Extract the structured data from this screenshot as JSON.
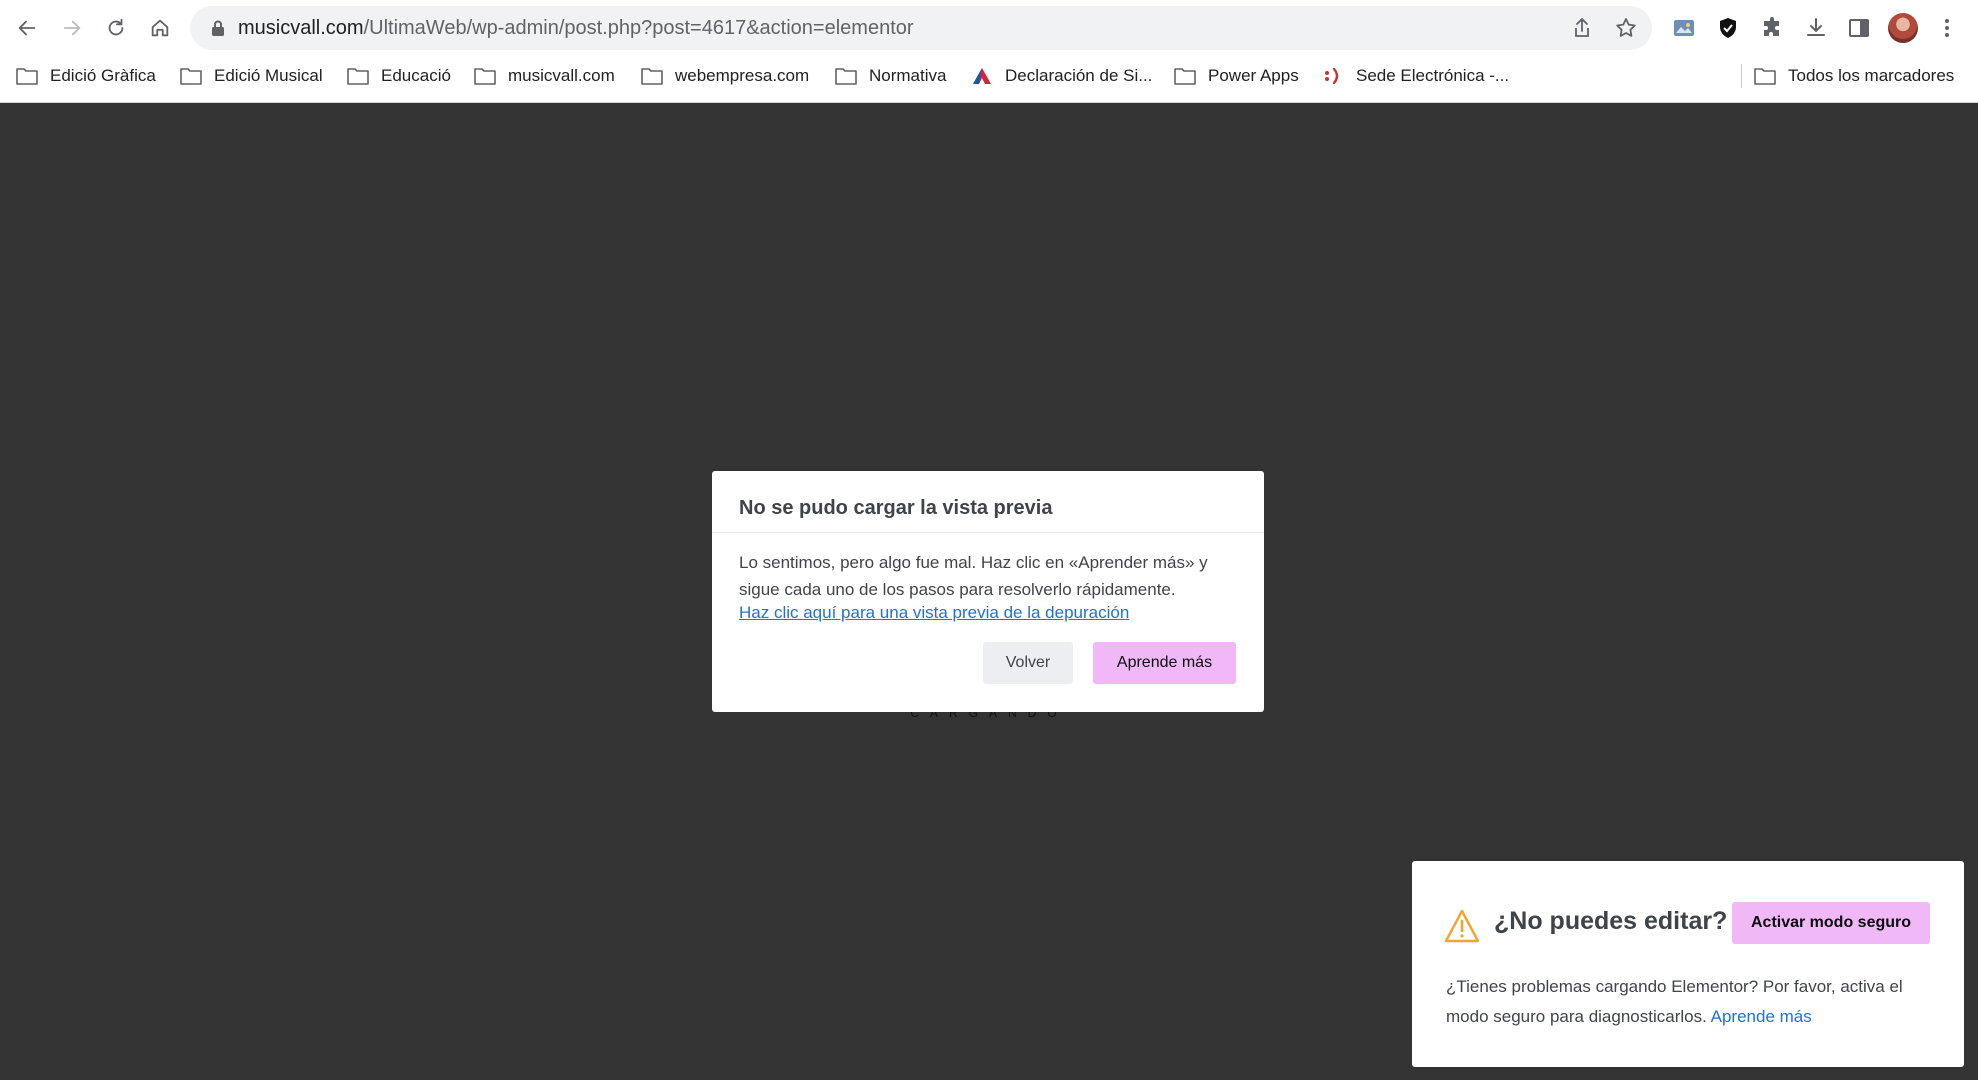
{
  "browser": {
    "url_host": "musicvall.com",
    "url_path": "/UltimaWeb/wp-admin/post.php?post=4617&action=elementor",
    "bookmarks": [
      {
        "label": "Edició Gràfica",
        "icon": "folder-icon"
      },
      {
        "label": "Edició Musical",
        "icon": "folder-icon"
      },
      {
        "label": "Educació",
        "icon": "folder-icon"
      },
      {
        "label": "musicvall.com",
        "icon": "folder-icon"
      },
      {
        "label": "webempresa.com",
        "icon": "folder-icon"
      },
      {
        "label": "Normativa",
        "icon": "folder-icon"
      },
      {
        "label": "Declaración de Si...",
        "icon": "autocad-logo-icon"
      },
      {
        "label": "Power Apps",
        "icon": "folder-icon"
      },
      {
        "label": "Sede Electrónica -...",
        "icon": "sede-logo-icon"
      }
    ],
    "all_bookmarks": "Todos los marcadores"
  },
  "background": {
    "loading_text": "CARGANDO"
  },
  "modal": {
    "title": "No se pudo cargar la vista previa",
    "message": "Lo sentimos, pero algo fue mal. Haz clic en «Aprender más» y sigue cada uno de los pasos para resolverlo rápidamente.",
    "debug_link": "Haz clic aquí para una vista previa de la depuración",
    "back_label": "Volver",
    "learn_label": "Aprende más"
  },
  "safe_mode_notice": {
    "title": "¿No puedes editar?",
    "button_label": "Activar modo seguro",
    "text": "¿Tienes problemas cargando Elementor? Por favor, activa el modo seguro para diagnosticarlos.",
    "learn_link": "Aprende más"
  },
  "colors": {
    "accent_pink": "#f0b8f7",
    "link_blue": "#2271d4",
    "warning_orange": "#f0a431",
    "overlay_bg": "#333333"
  }
}
